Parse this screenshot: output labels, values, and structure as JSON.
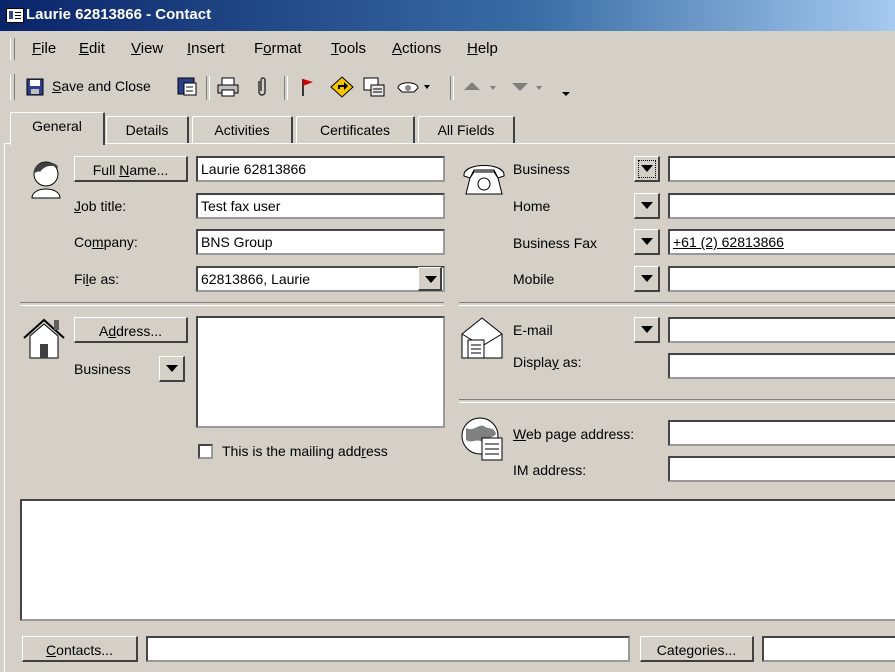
{
  "window": {
    "title": "Laurie 62813866 - Contact"
  },
  "menu": [
    {
      "pre": "",
      "key": "F",
      "post": "ile"
    },
    {
      "pre": "",
      "key": "E",
      "post": "dit"
    },
    {
      "pre": "",
      "key": "V",
      "post": "iew"
    },
    {
      "pre": "",
      "key": "I",
      "post": "nsert"
    },
    {
      "pre": "F",
      "key": "o",
      "post": "rmat"
    },
    {
      "pre": "",
      "key": "T",
      "post": "ools"
    },
    {
      "pre": "",
      "key": "A",
      "post": "ctions"
    },
    {
      "pre": "",
      "key": "H",
      "post": "elp"
    }
  ],
  "toolbar": {
    "save_close_pre": "",
    "save_close_key": "S",
    "save_close_post": "ave and Close"
  },
  "tabs": [
    "General",
    "Details",
    "Activities",
    "Certificates",
    "All Fields"
  ],
  "name_section": {
    "full_name_button": {
      "pre": "Full ",
      "key": "N",
      "post": "ame..."
    },
    "full_name_value": "Laurie 62813866",
    "job_title_label": {
      "pre": "",
      "key": "J",
      "post": "ob title:"
    },
    "job_title_value": "Test fax user",
    "company_label": {
      "pre": "Co",
      "key": "m",
      "post": "pany:"
    },
    "company_value": "BNS Group",
    "file_as_label": {
      "pre": "Fi",
      "key": "l",
      "post": "e as:"
    },
    "file_as_value": "62813866, Laurie"
  },
  "phones": [
    {
      "label": "Business",
      "value": ""
    },
    {
      "label": "Home",
      "value": ""
    },
    {
      "label": "Business Fax",
      "value": "+61 (2) 62813866"
    },
    {
      "label": "Mobile",
      "value": ""
    }
  ],
  "address": {
    "button": {
      "pre": "A",
      "key": "d",
      "post": "dress..."
    },
    "type": "Business",
    "value": "",
    "mailing_label": {
      "pre": "This is the mailing add",
      "key": "r",
      "post": "ess"
    },
    "mailing_checked": false
  },
  "email": {
    "label": "E-mail",
    "value": "",
    "display_label": {
      "pre": "Displa",
      "key": "y",
      "post": " as:"
    },
    "display_value": ""
  },
  "web": {
    "label": {
      "pre": "",
      "key": "W",
      "post": "eb page address:"
    },
    "value": "",
    "im_label": "IM address:",
    "im_value": ""
  },
  "notes": "",
  "footer": {
    "contacts_button": {
      "pre": "",
      "key": "C",
      "post": "ontacts..."
    },
    "contacts_value": "",
    "categories_button": {
      "pre": "Cate",
      "key": "g",
      "post": "ories..."
    },
    "categories_value": ""
  }
}
